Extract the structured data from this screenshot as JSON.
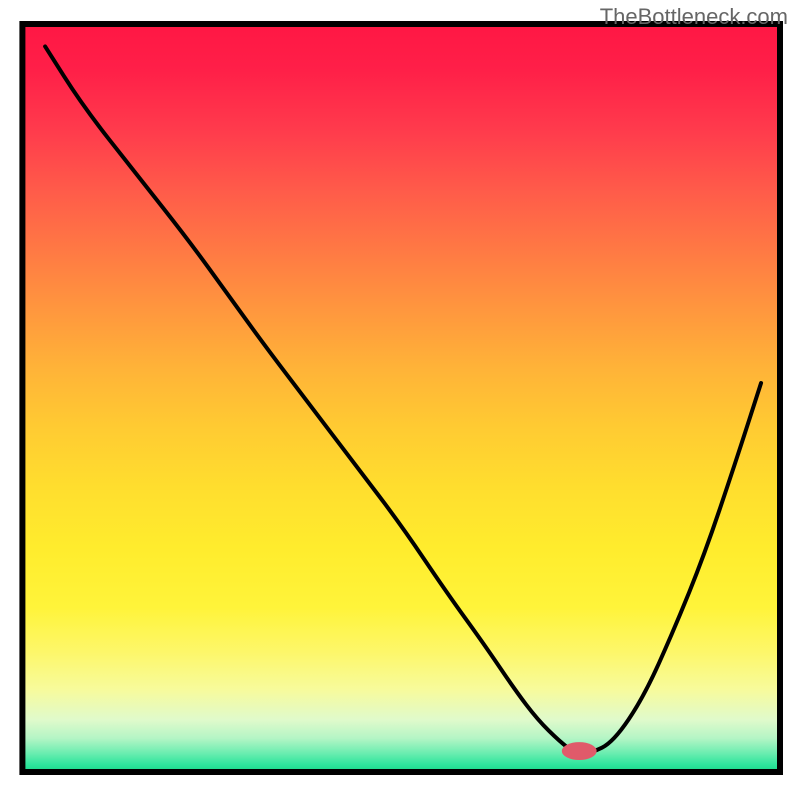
{
  "watermark": "TheBottleneck.com",
  "chart_data": {
    "type": "line",
    "title": "",
    "xlabel": "",
    "ylabel": "",
    "xlim": [
      0,
      100
    ],
    "ylim": [
      0,
      100
    ],
    "axes_visible": false,
    "grid": false,
    "gradient_stops": [
      {
        "offset": 0.0,
        "color": "#ff1744"
      },
      {
        "offset": 0.06,
        "color": "#ff1f48"
      },
      {
        "offset": 0.14,
        "color": "#ff3a4c"
      },
      {
        "offset": 0.22,
        "color": "#ff5a4a"
      },
      {
        "offset": 0.3,
        "color": "#ff7844"
      },
      {
        "offset": 0.38,
        "color": "#ff963e"
      },
      {
        "offset": 0.46,
        "color": "#ffb338"
      },
      {
        "offset": 0.54,
        "color": "#ffcb32"
      },
      {
        "offset": 0.62,
        "color": "#ffde2e"
      },
      {
        "offset": 0.7,
        "color": "#ffec2d"
      },
      {
        "offset": 0.78,
        "color": "#fff43a"
      },
      {
        "offset": 0.84,
        "color": "#fdf76a"
      },
      {
        "offset": 0.89,
        "color": "#f7fb9c"
      },
      {
        "offset": 0.93,
        "color": "#e0facb"
      },
      {
        "offset": 0.955,
        "color": "#b4f5c5"
      },
      {
        "offset": 0.975,
        "color": "#6aedb0"
      },
      {
        "offset": 0.99,
        "color": "#2fe59c"
      },
      {
        "offset": 1.0,
        "color": "#18d989"
      }
    ],
    "frame": {
      "x0": 2.8,
      "y0": 3.5,
      "x1": 97.5,
      "y1": 97.0
    },
    "series": [
      {
        "name": "bottleneck-curve",
        "x": [
          3,
          8,
          15,
          22,
          27,
          32,
          38,
          44,
          50,
          56,
          61,
          65,
          68,
          71,
          73,
          75,
          78,
          82,
          86,
          90,
          94,
          97.5
        ],
        "y": [
          97,
          89,
          80,
          71,
          64,
          57,
          49,
          41,
          33,
          24,
          17,
          11,
          7,
          4,
          2.5,
          2.5,
          4,
          10,
          19,
          29,
          41,
          52
        ]
      }
    ],
    "marker": {
      "x": 73.5,
      "y": 2.8,
      "rx": 2.3,
      "ry": 1.2,
      "color": "#e05a6a"
    }
  }
}
